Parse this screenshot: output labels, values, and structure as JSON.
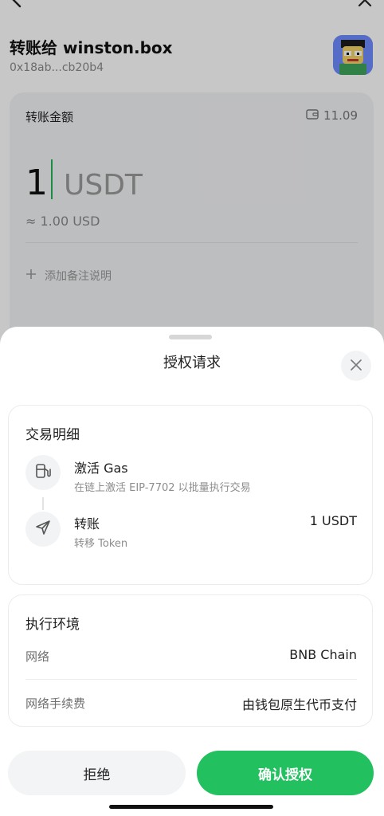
{
  "background": {
    "title": "转账给 winston.box",
    "address": "0x18ab...cb20b4",
    "amount_card": {
      "label": "转账金额",
      "balance": "11.09",
      "amount": "1",
      "unit": "USDT",
      "usd_value": "≈ 1.00 USD",
      "note_placeholder": "添加备注说明"
    }
  },
  "sheet": {
    "title": "授权请求",
    "detail": {
      "heading": "交易明细",
      "steps": [
        {
          "icon": "gas-pump-icon",
          "title": "激活 Gas",
          "subtitle": "在链上激活 EIP-7702 以批量执行交易",
          "value": ""
        },
        {
          "icon": "send-icon",
          "title": "转账",
          "subtitle": "转移 Token",
          "value": "1 USDT"
        }
      ]
    },
    "environment": {
      "heading": "执行环境",
      "rows": [
        {
          "label": "网络",
          "value": "BNB Chain"
        },
        {
          "label": "网络手续费",
          "value": "由钱包原生代币支付"
        }
      ]
    },
    "buttons": {
      "reject": "拒绝",
      "confirm": "确认授权"
    }
  },
  "colors": {
    "accent": "#22c05f",
    "overlay": "rgba(0,0,0,0.22)"
  }
}
